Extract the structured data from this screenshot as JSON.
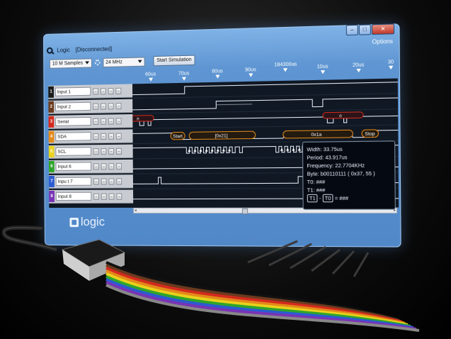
{
  "window": {
    "title": "Logic",
    "status": "[Disconnected]",
    "options_label": "Options",
    "buttons": {
      "minimize": "–",
      "maximize": "□",
      "close": "✕"
    }
  },
  "toolbar": {
    "samples": "10 M Samples",
    "rate": "24 MHz",
    "start_label": "Start Simulation"
  },
  "ruler": {
    "ticks": [
      "60us",
      "70us",
      "80us",
      "90us",
      "184300us",
      "10us",
      "20us",
      "30"
    ]
  },
  "channels": [
    {
      "num": "1",
      "name": "Input 1",
      "color": "#1b1b1b"
    },
    {
      "num": "2",
      "name": "Input 2",
      "color": "#6b3a1e"
    },
    {
      "num": "3",
      "name": "Serial",
      "color": "#d42a1e"
    },
    {
      "num": "4",
      "name": "SDA",
      "color": "#e48a1a"
    },
    {
      "num": "5",
      "name": "SCL",
      "color": "#e9d21c"
    },
    {
      "num": "6",
      "name": "Input 6",
      "color": "#2fa52b"
    },
    {
      "num": "7",
      "name": "Inpu t 7",
      "color": "#2c5bd1"
    },
    {
      "num": "8",
      "name": "Input 8",
      "color": "#7a33b5"
    }
  ],
  "channel_buttons": [
    "–",
    "–",
    "–",
    "–"
  ],
  "decodes": {
    "serial_left": "n",
    "serial_right": "o",
    "start": "Start",
    "addr": "[0x21]",
    "byte": "0x1a",
    "stop": "Stop"
  },
  "tooltip": {
    "width": "Width: 33.75us",
    "period": "Period: 43.917us",
    "frequency": "Frequency: 22.7704KHz",
    "byte": "Byte: b00110111 ( 0x37, 55 )",
    "t0": "T0: ###",
    "t1": "T1: ###",
    "t1_chip": "T1",
    "minus": "-",
    "t0_chip": "T0",
    "diff": "= ###"
  },
  "brand": {
    "name": "logic"
  },
  "scroll": {
    "left": "◂",
    "right": "▸"
  }
}
